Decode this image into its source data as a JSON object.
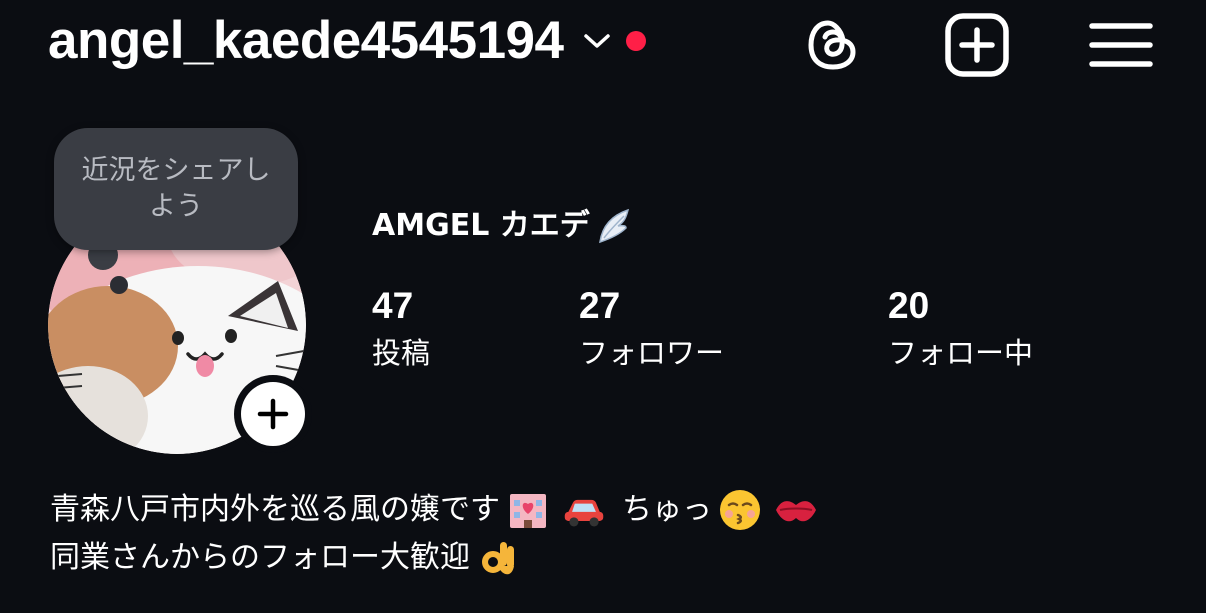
{
  "header": {
    "username": "angel_kaede4545194",
    "icons": [
      "chevron-down-icon",
      "threads-icon",
      "create-post-icon",
      "menu-icon"
    ],
    "notif_color": "#ff1f47"
  },
  "note": {
    "text": "近況をシェアしよう"
  },
  "profile": {
    "display_name": "AMGEL カエデ",
    "stats": [
      {
        "count": "47",
        "label": "投稿"
      },
      {
        "count": "27",
        "label": "フォロワー"
      },
      {
        "count": "20",
        "label": "フォロー中"
      }
    ]
  },
  "bio": {
    "line1": "青森八戸市内外を巡る風の嬢です",
    "line1_extra": "ちゅっ",
    "line2": "同業さんからのフォロー大歓迎",
    "emojis": [
      "love-hotel-emoji",
      "car-emoji",
      "kissing-face-emoji",
      "kiss-mark-emoji",
      "ok-hand-emoji",
      "wing-emoji"
    ]
  },
  "colors": {
    "background": "#0b0d12",
    "bubble": "#3a3d44",
    "text": "#ffffff"
  }
}
